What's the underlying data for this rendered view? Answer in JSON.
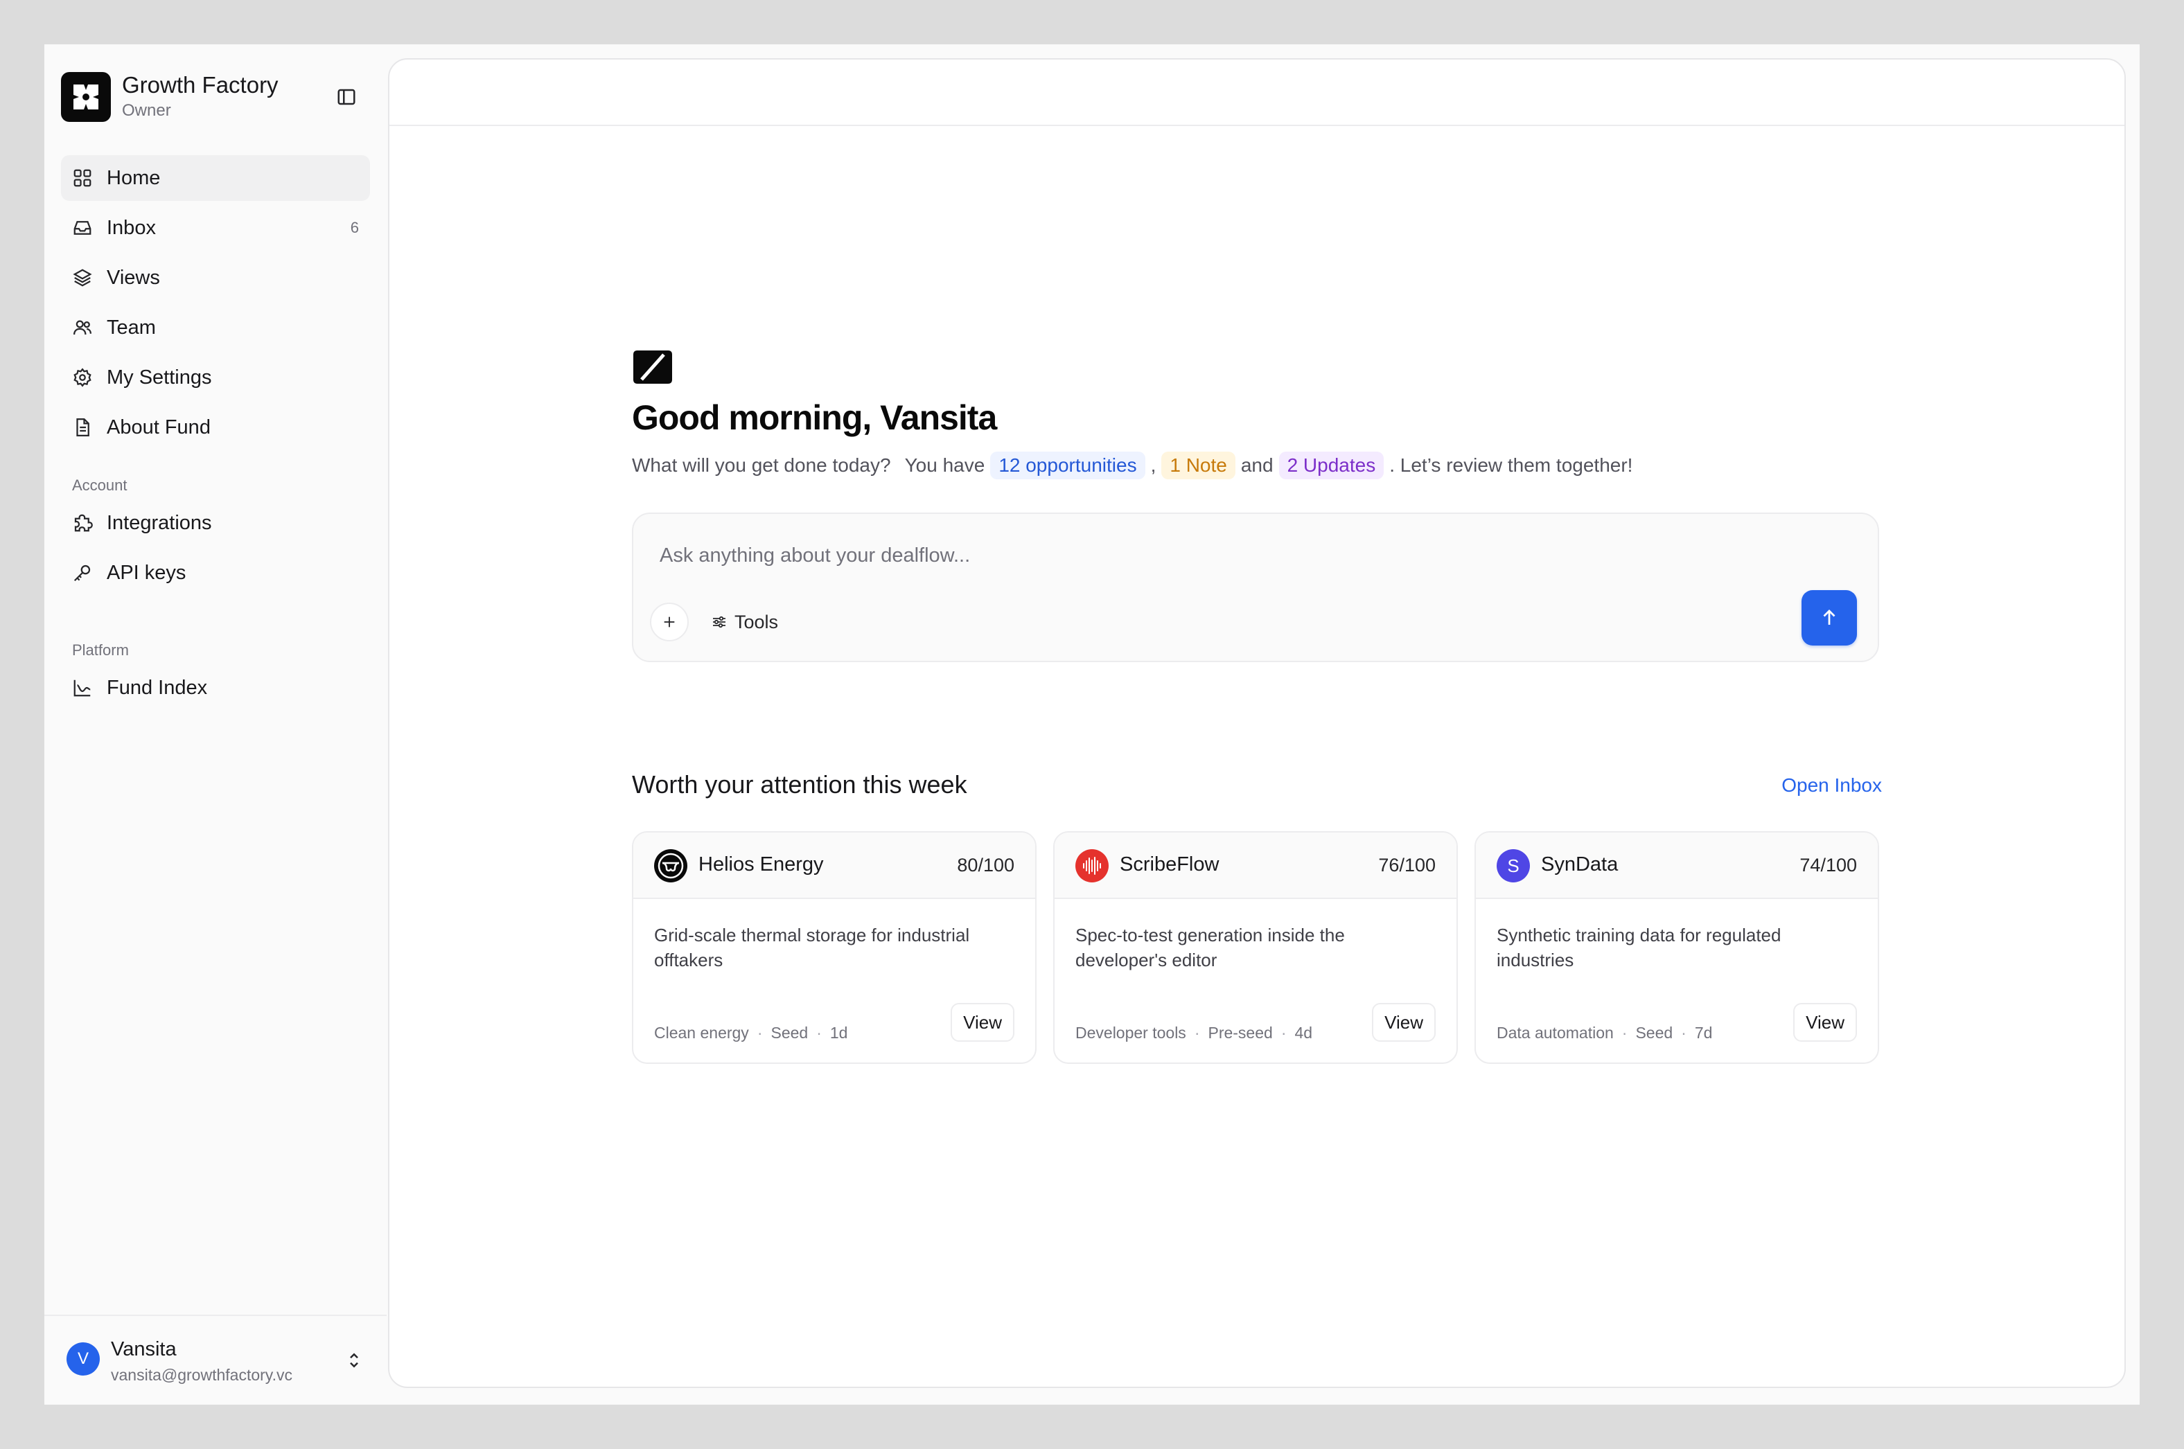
{
  "workspace": {
    "name": "Growth Factory",
    "role": "Owner"
  },
  "nav": {
    "items": [
      {
        "label": "Home",
        "icon": "grid-icon",
        "active": true
      },
      {
        "label": "Inbox",
        "icon": "inbox-icon",
        "count": "6"
      },
      {
        "label": "Views",
        "icon": "layers-icon"
      },
      {
        "label": "Team",
        "icon": "users-icon"
      },
      {
        "label": "My Settings",
        "icon": "gear-icon"
      },
      {
        "label": "About Fund",
        "icon": "document-icon"
      }
    ],
    "account_label": "Account",
    "account_items": [
      {
        "label": "Integrations",
        "icon": "puzzle-icon"
      },
      {
        "label": "API keys",
        "icon": "key-icon"
      }
    ],
    "platform_label": "Platform",
    "platform_items": [
      {
        "label": "Fund Index",
        "icon": "chart-line-icon"
      }
    ]
  },
  "user": {
    "initial": "V",
    "name": "Vansita",
    "email": "vansita@growthfactory.vc"
  },
  "hero": {
    "greeting": "Good morning, Vansita",
    "prompt": "What will you get done today?",
    "you_have": "You have",
    "opportunities": "12 opportunities",
    "comma": ",",
    "notes": "1 Note",
    "and": "and",
    "updates": "2 Updates",
    "closing": ". Let’s review them together!"
  },
  "composer": {
    "placeholder": "Ask anything about your dealflow...",
    "tools_label": "Tools"
  },
  "attention": {
    "title": "Worth your attention this week",
    "open_inbox": "Open Inbox",
    "cards": [
      {
        "name": "Helios Energy",
        "score": "80/100",
        "description": "Grid-scale thermal storage for industrial offtakers",
        "sector": "Clean energy",
        "stage": "Seed",
        "age": "1d",
        "view_label": "View",
        "logo_color": "#0a0a0a"
      },
      {
        "name": "ScribeFlow",
        "score": "76/100",
        "description": "Spec-to-test generation inside the developer's editor",
        "sector": "Developer tools",
        "stage": "Pre-seed",
        "age": "4d",
        "view_label": "View",
        "logo_color": "#e5322d"
      },
      {
        "name": "SynData",
        "score": "74/100",
        "description": "Synthetic training data for regulated industries",
        "sector": "Data automation",
        "stage": "Seed",
        "age": "7d",
        "view_label": "View",
        "logo_color": "#4f46e5",
        "logo_letter": "S"
      }
    ]
  },
  "colors": {
    "accent": "#2563eb",
    "background": "#fafafa",
    "border": "#ececee"
  }
}
